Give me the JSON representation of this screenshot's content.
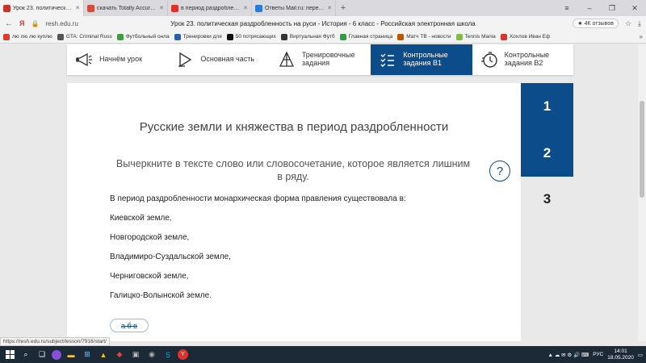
{
  "browser": {
    "tabs": [
      {
        "label": "Урок 23. политическая р",
        "color": "#c8322b",
        "active": true
      },
      {
        "label": "скачать Totally Accurate Ba",
        "color": "#d84a3a"
      },
      {
        "label": "в период раздробленност",
        "color": "#e0302a"
      },
      {
        "label": "Ответы Mail.ru: переход л",
        "color": "#2a7ad8"
      }
    ],
    "new_tab": "+",
    "window_controls": {
      "menu": "≡",
      "minimize": "–",
      "restore": "❐",
      "close": "✕"
    },
    "address": {
      "domain": "resh.edu.ru",
      "page_title": "Урок 23. политическая раздробленность на руси - История - 6 класс - Российская электронная школа",
      "reviews": "4К отзывов"
    },
    "bookmarks": [
      {
        "label": "лю лю лю куплю",
        "color": "#e03a2a"
      },
      {
        "label": "GTA: Criminal Russ",
        "color": "#555555"
      },
      {
        "label": "Футбольный онла",
        "color": "#3aa13a"
      },
      {
        "label": "Тренировки для",
        "color": "#2a5fb0"
      },
      {
        "label": "50 потрясающих",
        "color": "#111111"
      },
      {
        "label": "Виртуальная Футб",
        "color": "#333333"
      },
      {
        "label": "Главная страница",
        "color": "#2ea043"
      },
      {
        "label": "Матч ТВ - новости",
        "color": "#c05500"
      },
      {
        "label": "Tennis Mania",
        "color": "#7fbf3f"
      },
      {
        "label": "Хохлов Иван Еф",
        "color": "#e0302a"
      }
    ],
    "bookmarks_more": "»"
  },
  "lesson_nav": [
    {
      "label": "Начнём урок",
      "icon": "megaphone-icon",
      "active": false
    },
    {
      "label": "Основная часть",
      "icon": "play-icon",
      "active": false
    },
    {
      "label": "Тренировочные задания",
      "icon": "pyramid-icon",
      "active": false
    },
    {
      "label": "Контрольные задания B1",
      "icon": "checklist-icon",
      "active": true
    },
    {
      "label": "Контрольные задания B2",
      "icon": "timer-icon",
      "active": false
    }
  ],
  "task": {
    "title": "Русские земли и княжества в период раздробленности",
    "instruction": "Вычеркните в тексте слово или словосочетание, которое является лишним в ряду.",
    "help": "?",
    "question": "В период раздробленности монархическая форма правления существовала в:",
    "options": [
      "Киевской земле,",
      "Новгородской земле,",
      "Владимиро-Суздальской земле,",
      "Черниговской земле,",
      "Галицко-Волынской земле."
    ],
    "answer_badge": "а б в"
  },
  "task_numbers": [
    {
      "label": "1",
      "done": true
    },
    {
      "label": "2",
      "done": true
    },
    {
      "label": "3",
      "done": false
    }
  ],
  "status_url": "https://resh.edu.ru/subject/lesson/7916/start/",
  "taskbar": {
    "language": "РУС",
    "time": "14:01",
    "date": "18.05.2020"
  }
}
